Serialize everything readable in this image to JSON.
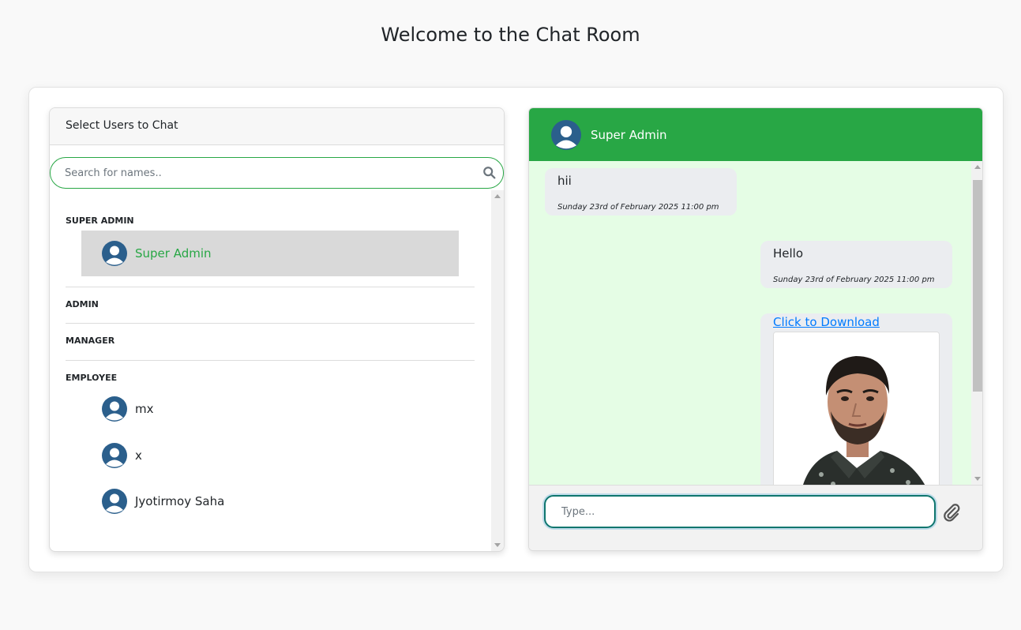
{
  "page": {
    "title": "Welcome to the Chat Room"
  },
  "sidebar": {
    "header": "Select Users to Chat",
    "search": {
      "placeholder": "Search for names..",
      "value": ""
    },
    "groups": [
      {
        "label": "SUPER ADMIN",
        "users": [
          {
            "name": "Super Admin",
            "active": true
          }
        ]
      },
      {
        "label": "ADMIN",
        "users": []
      },
      {
        "label": "MANAGER",
        "users": []
      },
      {
        "label": "EMPLOYEE",
        "users": [
          {
            "name": "mx"
          },
          {
            "name": "x"
          },
          {
            "name": "Jyotirmoy Saha"
          }
        ]
      }
    ]
  },
  "chat": {
    "header_name": "Super Admin",
    "messages": [
      {
        "side": "left",
        "text": "hii",
        "time": "Sunday 23rd of February 2025 11:00 pm"
      },
      {
        "side": "right",
        "text": "Hello",
        "time": "Sunday 23rd of February 2025 11:00 pm"
      },
      {
        "side": "right",
        "link": "Click to Download",
        "has_image": true
      }
    ],
    "composer": {
      "placeholder": "Type...",
      "value": ""
    }
  },
  "colors": {
    "accent": "#28a745",
    "chat_bg": "#e5fde5",
    "bubble": "#ebedf0",
    "link": "#007bff",
    "avatar": "#2b5f8c"
  },
  "icons": {
    "search": "search-icon",
    "avatar": "user-avatar-icon",
    "attach": "paperclip-icon",
    "scroll_up": "scroll-up-icon",
    "scroll_down": "scroll-down-icon"
  }
}
